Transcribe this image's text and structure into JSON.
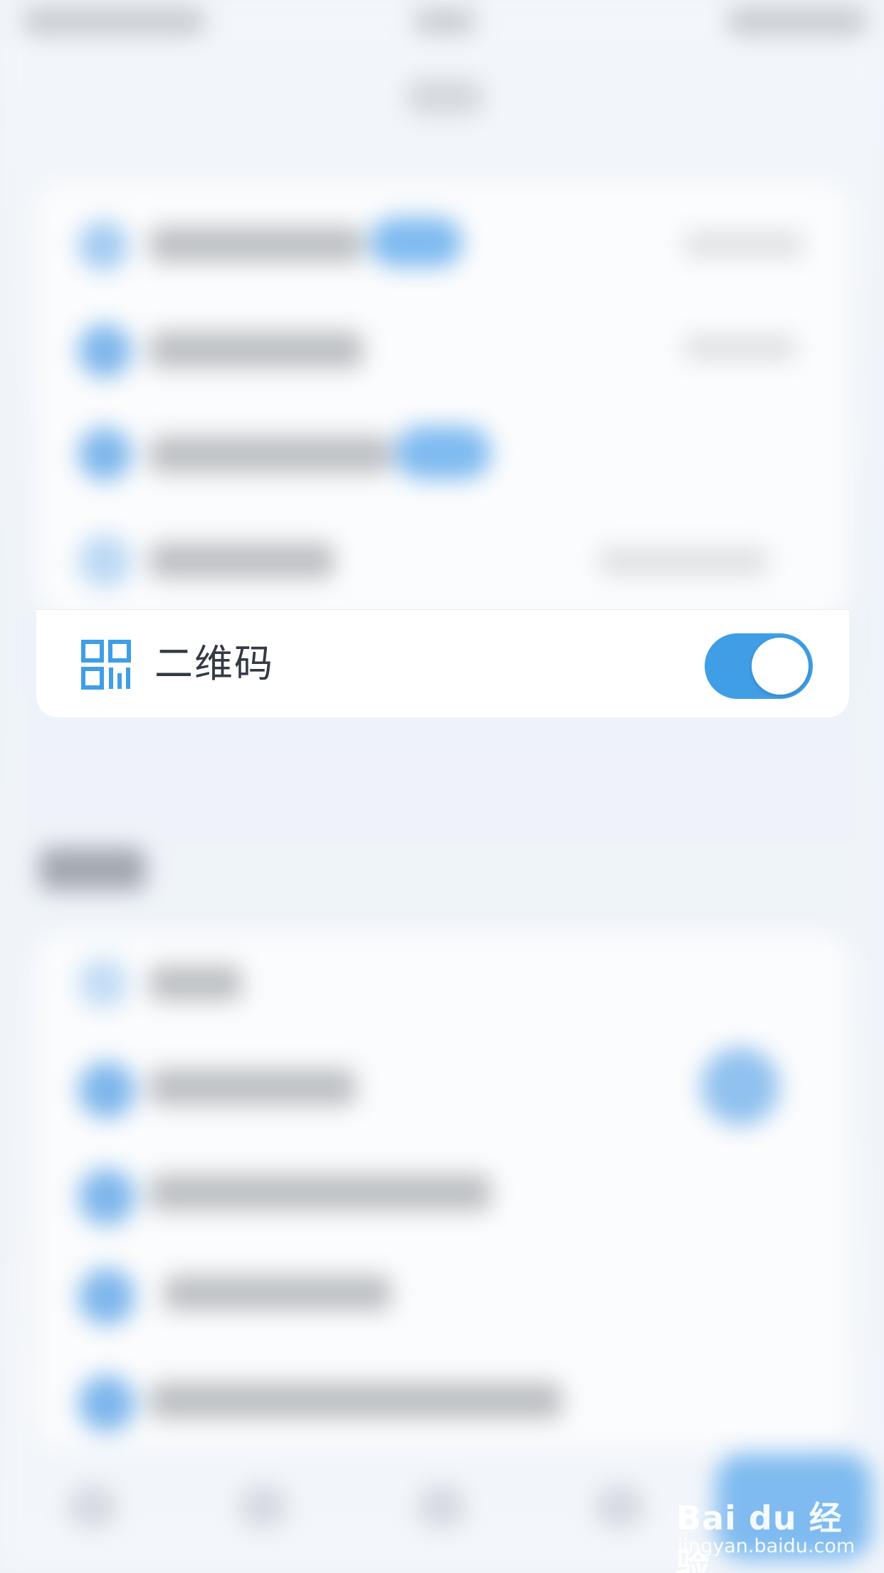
{
  "setting_row": {
    "label": "二维码",
    "icon": "qr-code-icon",
    "toggle_on": true
  },
  "colors": {
    "accent": "#3f9ee6",
    "label_text": "#333a44",
    "card_bg": "#ffffff",
    "page_bg": "#eef3f9"
  },
  "watermark": {
    "logo_text": "Bai du 经验",
    "url": "jingyan.baidu.com"
  }
}
